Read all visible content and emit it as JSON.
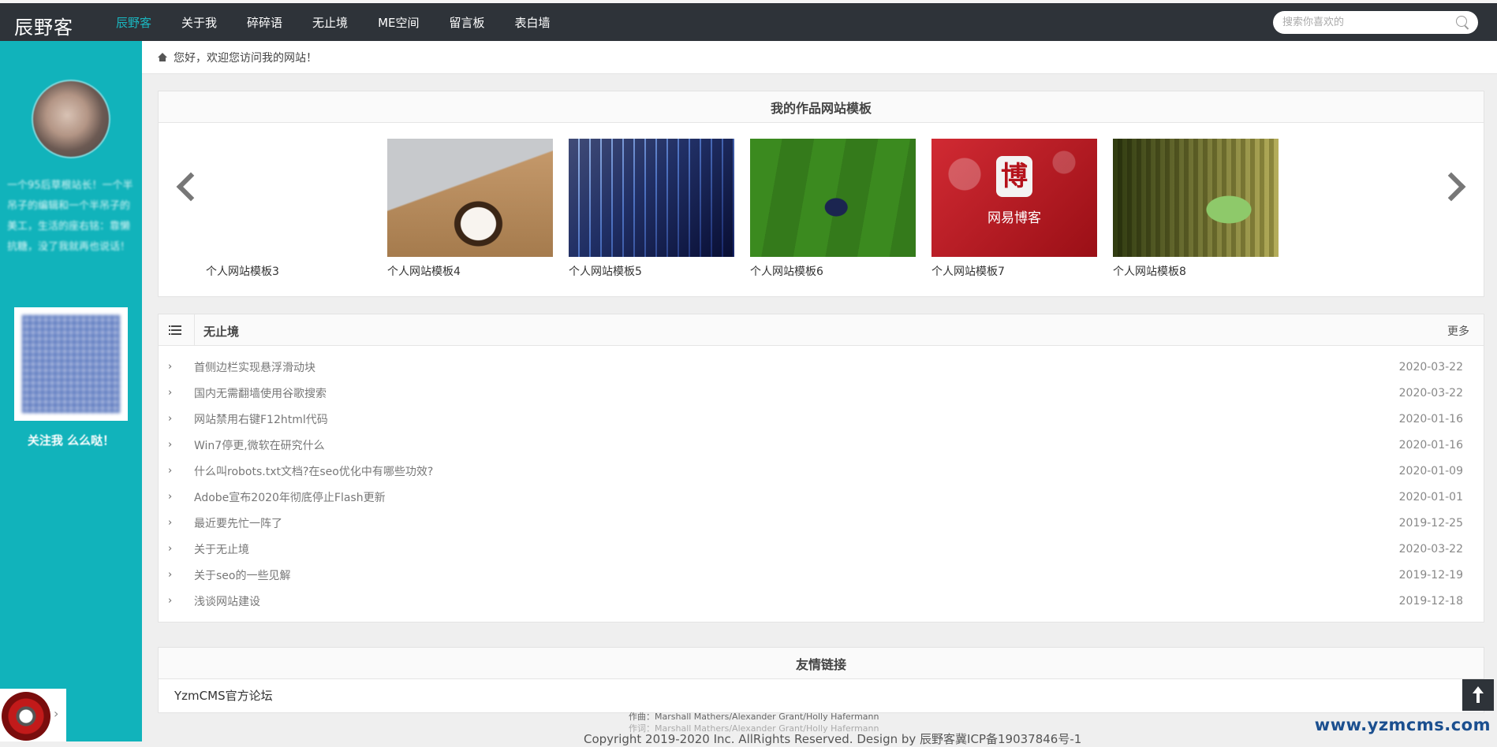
{
  "site": {
    "logo": "辰野客"
  },
  "nav": {
    "items": [
      "辰野客",
      "关于我",
      "碎碎语",
      "无止境",
      "ME空间",
      "留言板",
      "表白墙"
    ],
    "active_index": 0
  },
  "search": {
    "placeholder": "搜索你喜欢的",
    "icon": "search-icon"
  },
  "sidebar": {
    "intro": "一个95后草根站长！一个半吊子的编辑和一个半吊子的美工，生活的座右铭：靠懒抗糖，没了我就再也说话！",
    "follow_label": "关注我 么么哒！"
  },
  "breadcrumb": {
    "text": "您好，欢迎您访问我的网站！",
    "icon": "home-icon"
  },
  "works": {
    "title": "我的作品网站模板",
    "items": [
      {
        "caption": "个人网站模板3"
      },
      {
        "caption": "个人网站模板4"
      },
      {
        "caption": "个人网站模板5"
      },
      {
        "caption": "个人网站模板6"
      },
      {
        "caption": "个人网站模板7",
        "image_text": "网易博客",
        "image_glyph": "博"
      },
      {
        "caption": "个人网站模板8"
      }
    ]
  },
  "articles": {
    "title": "无止境",
    "more_label": "更多",
    "items": [
      {
        "title": "首侧边栏实现悬浮滑动块",
        "date": "2020-03-22"
      },
      {
        "title": "国内无需翻墙使用谷歌搜索",
        "date": "2020-03-22"
      },
      {
        "title": "网站禁用右键F12html代码",
        "date": "2020-01-16"
      },
      {
        "title": "Win7停更,微软在研究什么",
        "date": "2020-01-16"
      },
      {
        "title": "什么叫robots.txt文档?在seo优化中有哪些功效?",
        "date": "2020-01-09"
      },
      {
        "title": "Adobe宣布2020年彻底停止Flash更新",
        "date": "2020-01-01"
      },
      {
        "title": "最近要先忙一阵了",
        "date": "2019-12-25"
      },
      {
        "title": "关于无止境",
        "date": "2020-03-22"
      },
      {
        "title": "关于seo的一些见解",
        "date": "2019-12-19"
      },
      {
        "title": "浅谈网站建设",
        "date": "2019-12-18"
      }
    ]
  },
  "friends": {
    "title": "友情链接",
    "links": [
      "YzmCMS官方论坛"
    ]
  },
  "footer": {
    "credit1": "作曲：Marshall Mathers/Alexander Grant/Holly Hafermann",
    "credit2": "作词：Marshall Mathers/Alexander Grant/Holly Hafermann",
    "copyright": "Copyright 2019-2020 Inc. AllRights Reserved. Design by 辰野客冀ICP备19037846号-1",
    "watermark": "www.yzmcms.com"
  },
  "colors": {
    "accent": "#11b3bb",
    "topbar": "#2e3339"
  }
}
